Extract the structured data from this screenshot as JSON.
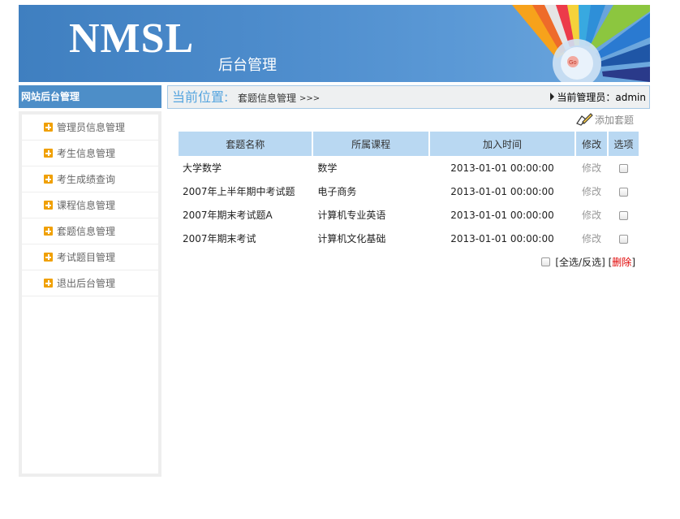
{
  "banner": {
    "brand": "NMSL",
    "subtitle": "后台管理",
    "go_label": "Go"
  },
  "sidebar": {
    "title": "网站后台管理",
    "items": [
      {
        "label": "管理员信息管理"
      },
      {
        "label": "考生信息管理"
      },
      {
        "label": "考生成绩查询"
      },
      {
        "label": "课程信息管理"
      },
      {
        "label": "套题信息管理"
      },
      {
        "label": "考试题目管理"
      },
      {
        "label": "退出后台管理"
      }
    ]
  },
  "location": {
    "label": "当前位置:",
    "page": "套题信息管理",
    "arrows": ">>>",
    "admin": "当前管理员：admin"
  },
  "actions": {
    "add_label": "添加套题"
  },
  "table": {
    "headers": [
      "套题名称",
      "所属课程",
      "加入时间",
      "修改",
      "选项"
    ],
    "rows": [
      {
        "name": "大学数学",
        "course": "数学",
        "time": "2013-01-01 00:00:00",
        "edit": "修改"
      },
      {
        "name": "2007年上半年期中考试题",
        "course": "电子商务",
        "time": "2013-01-01 00:00:00",
        "edit": "修改"
      },
      {
        "name": "2007年期末考试题A",
        "course": "计算机专业英语",
        "time": "2013-01-01 00:00:00",
        "edit": "修改"
      },
      {
        "name": "2007年期末考试",
        "course": "计算机文化基础",
        "time": "2013-01-01 00:00:00",
        "edit": "修改"
      }
    ]
  },
  "footer": {
    "select_all": "[全选/反选]",
    "delete_open": "[",
    "delete_label": "删除",
    "delete_close": "]"
  },
  "colors": {
    "banner_blue": "#4d8ccc",
    "header_blue": "#b9d8f2",
    "accent_blue": "#56a5df",
    "delete_red": "#e00000",
    "plus_orange": "#f0a000"
  }
}
